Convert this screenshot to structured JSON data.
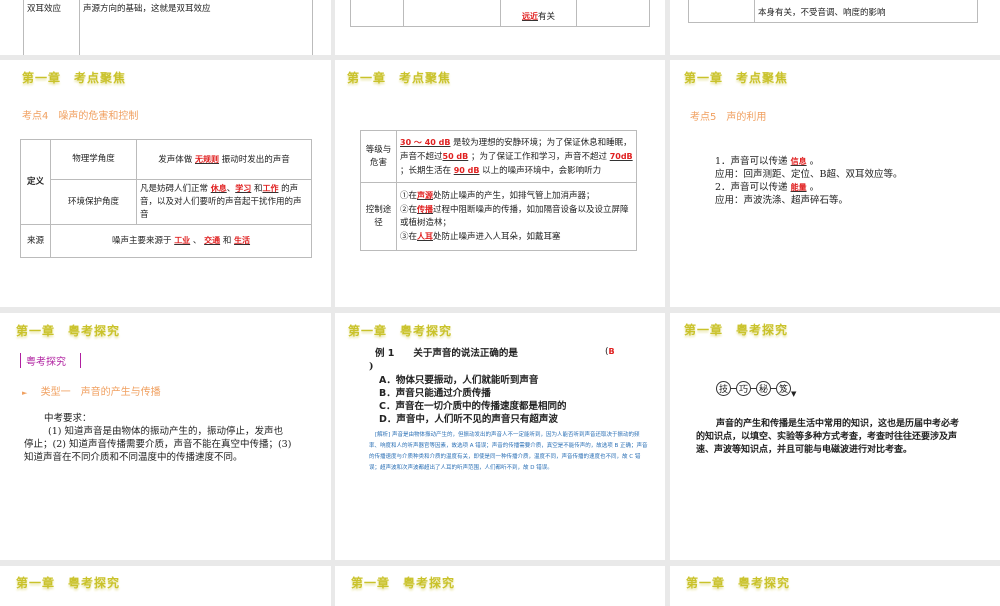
{
  "slides_top": [
    {
      "cell_label": "双耳效应",
      "cell_text": "声源方向的基础，这就是双耳效应"
    },
    {
      "blank": "远近",
      "text": "有关"
    },
    {
      "text": "本身有关，不受音调、响度的影响"
    }
  ],
  "s4": {
    "title": "第一章　考点聚焦",
    "subtitle": "考点4　噪声的危害和控制",
    "def_label": "定义",
    "phys_label": "物理学角度",
    "phys_pre": "发声体做",
    "phys_blank": "无规则",
    "phys_post": "振动时发出的声音",
    "env_label": "环境保护角度",
    "env_pre": "凡是妨碍人们正常",
    "env_b1": "休息",
    "env_sep": "、",
    "env_b2": "学习",
    "env_and": "和",
    "env_b3": "工作",
    "env_post": "的声音，以及对人们要听的声音起干扰作用的声音",
    "src_label": "来源",
    "src_pre": "噪声主要来源于",
    "src_b1": "工业",
    "src_sep": "、",
    "src_b2": "交通",
    "src_and": "和",
    "src_b3": "生活"
  },
  "s5": {
    "title": "第一章　考点聚焦",
    "lvl_label": "等级与危害",
    "lvl_b1": "30 ～ 40 dB",
    "lvl_t1": "是较为理想的安静环境；为了保证休息和睡眠，声音不超过",
    "lvl_b2": "50 dB",
    "lvl_t2": "；为了保证工作和学习，声音不超过",
    "lvl_b3": "70dB",
    "lvl_t3": "；长期生活在",
    "lvl_b4": "90 dB",
    "lvl_t4": "以上的噪声环境中，会影响听力",
    "ctl_label": "控制途径",
    "c1_pre": "①在",
    "c1_b": "声源",
    "c1_post": "处防止噪声的产生，如排气管上加消声器；",
    "c2_pre": "②在",
    "c2_b": "传播",
    "c2_post": "过程中阻断噪声的传播，如加隔音设备以及设立屏障或植树造林；",
    "c3_pre": "③在",
    "c3_b": "人耳",
    "c3_post": "处防止噪声进入人耳朵，如戴耳塞"
  },
  "s6": {
    "title": "第一章　考点聚焦",
    "subtitle": "考点5　声的利用",
    "l1_pre": "1．声音可以传递",
    "l1_b": "信息",
    "l1_post": "。",
    "l2": "应用：回声测距、定位、B超、双耳效应等。",
    "l3_pre": "2．声音可以传递",
    "l3_b": "能量",
    "l3_post": "。",
    "l4": "应用：声波洗涤、超声碎石等。"
  },
  "s7": {
    "title": "第一章　粤考探究",
    "section": "粤考探究",
    "type": "类型一　声音的产生与传播",
    "req_label": "中考要求：",
    "req_text": "(1) 知道声音是由物体的振动产生的，振动停止，发声也停止；(2) 知道声音传播需要介质，声音不能在真空中传播；(3) 知道声音在不同介质和不同温度中的传播速度不同。"
  },
  "s8": {
    "title": "第一章　粤考探究",
    "q": "例 1　　关于声音的说法正确的是",
    "paren": "(　　　)",
    "answer": "B",
    "options": [
      "A．物体只要振动，人们就能听到声音",
      "B．声音只能通过介质传播",
      "C．声音在一切介质中的传播速度都是相同的",
      "D．声音中，人们听不见的声音只有超声波"
    ],
    "analysis_label": "[解析]",
    "analysis": "声音是由物体振动产生的，但振动发出的声音人不一定能听到，因为人能否听到声音还取决于振动的频率、响度和人的听声器官等因素，故选项 A 错误；声音的传播需要介质，真空是不能传声的，故选项 B 正确；声音的传播速度与介质种类和介质的温度有关，即使是同一种传播介质，温度不同，声音传播的速度也不同，故 C 错误；超声波和次声波都超出了人耳的听声范围，人们都听不到，故 D 错误。"
  },
  "s9": {
    "title": "第一章　粤考探究",
    "tips": [
      "技",
      "巧",
      "秘",
      "笈"
    ],
    "text": "声音的产生和传播是生活中常用的知识，这也是历届中考必考的知识点，以填空、实验等多种方式考查，考查时往往还要涉及声速、声波等知识点，并且可能与电磁波进行对比考查。"
  },
  "bottom_titles": [
    "第一章　粤考探究",
    "第一章　粤考探究",
    "第一章　粤考探究"
  ]
}
